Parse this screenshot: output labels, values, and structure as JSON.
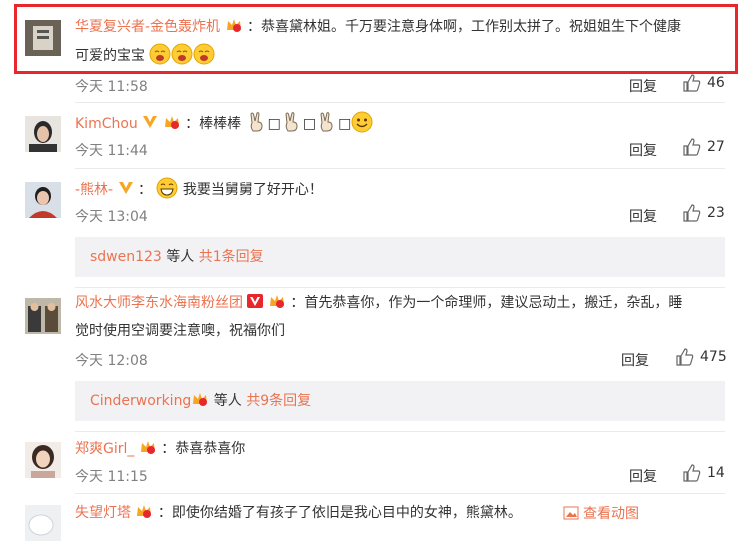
{
  "comments": [
    {
      "name": "华夏复兴者-金色轰炸机",
      "text_line1": "：恭喜黛林姐。千万要注意身体啊，工作别太拼了。祝姐姐生下个健康",
      "text_line2": "可爱的宝宝",
      "time": "今天 11:58",
      "reply": "回复",
      "likes": "46"
    },
    {
      "name": "KimChou",
      "text": "：棒棒棒",
      "sq": "□",
      "time": "今天 11:44",
      "reply": "回复",
      "likes": "27"
    },
    {
      "name": "-熊林-",
      "text": "我要当舅舅了好开心！",
      "sep": "：",
      "time": "今天 13:04",
      "reply": "回复",
      "likes": "23",
      "replies_box": {
        "user": "sdwen123",
        "mid": " 等人 ",
        "link": "共1条回复"
      }
    },
    {
      "name": "风水大师李东水海南粉丝团",
      "text_line1": "：首先恭喜你，作为一个命理师，建议忌动土，搬迁，杂乱，睡",
      "text_line2": "觉时使用空调要注意噢，祝福你们",
      "time": "今天 12:08",
      "reply": "回复",
      "likes": "475",
      "replies_box": {
        "user": "Cinderworking",
        "mid": " 等人 ",
        "link": "共9条回复"
      }
    },
    {
      "name": "郑爽Girl_",
      "text": "：恭喜恭喜你",
      "time": "今天 11:15",
      "reply": "回复",
      "likes": "14"
    },
    {
      "name": "失望灯塔",
      "text": "：即使你结婚了有孩子了依旧是我心目中的女神，熊黛林。",
      "view_image": "查看动图"
    }
  ],
  "colors": {
    "accent": "#eb7350",
    "highlight": "#e8272d",
    "box_bg": "#f2f2f5"
  }
}
